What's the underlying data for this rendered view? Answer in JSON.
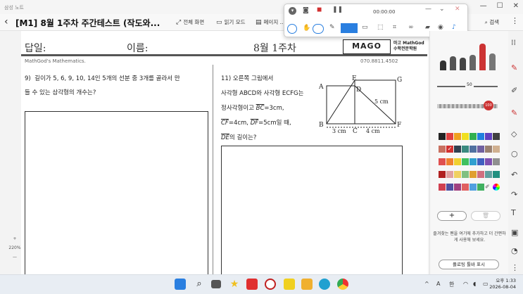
{
  "titlebar": {
    "app_name": "삼성 노트"
  },
  "docbar": {
    "title": "[M1] 8월 1주차 주간테스트 (작도와...",
    "buttons": {
      "fullscreen": "전체 화면",
      "read_mode": "읽기 모드",
      "page": "페이지 ...",
      "search": "검색"
    }
  },
  "page": {
    "header": {
      "answer": "답일:",
      "name": "이름:",
      "week": "8월 1주차",
      "logo": "MAGO",
      "logo_sub1": "마고 MathGod",
      "logo_sub2": "수학전문학원",
      "subtitle": "MathGod's Mathematics.",
      "phone": "070.8811.4502"
    },
    "q9": {
      "number": "9)",
      "line1": "길이가 5, 6, 9, 10, 14인 5개의 선분 중 3개를 골라서 만",
      "line2": "들 수 있는 삼각형의 개수는?"
    },
    "q11": {
      "number": "11)",
      "line1": "오른쪽 그림에서",
      "line2": "사각형 ABCD와 사각형 ECFG는",
      "line3": "정사각형이고",
      "bc": "BC",
      "bc_val": "=3cm,",
      "cf": "CF",
      "cf_val": "=4cm,",
      "df": "DF",
      "df_val": "=5cm일 때,",
      "de": "DE",
      "de_val": "의 길이는?"
    },
    "figure": {
      "labels": {
        "A": "A",
        "B": "B",
        "C": "C",
        "D": "D",
        "E": "E",
        "F": "F",
        "G": "G"
      },
      "len_bc": "3 cm",
      "len_cf": "4 cm",
      "len_df": "5 cm"
    }
  },
  "zoom": {
    "plus": "+",
    "level": "220%",
    "minus": "—"
  },
  "recorder": {
    "time": "00:00:00"
  },
  "pen_panel": {
    "size_value": "50",
    "opacity_value": "100",
    "add": "+",
    "note": "즐겨찾는 펜을 여기에 추가하고 더 간편하게 사용해 보세요.",
    "float_toolbar": "플로팅 툴바 표시"
  },
  "colors": {
    "accent": "#2a7fe0",
    "record": "#d23030"
  },
  "tray": {
    "ime": "A",
    "lang": "한",
    "time": "오후 1:33",
    "date": "2026-08-04"
  }
}
